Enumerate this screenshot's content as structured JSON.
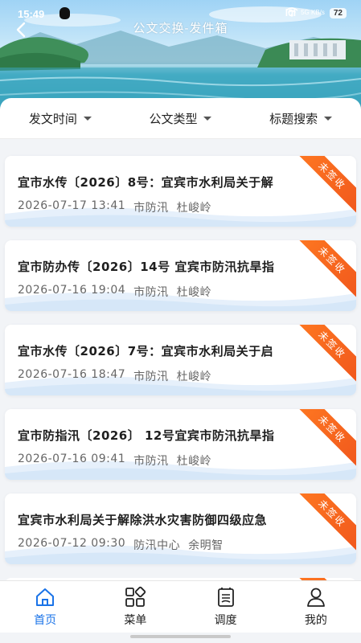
{
  "status_bar": {
    "time": "15:49",
    "signal": "l0l",
    "network": "5G\nKB/s",
    "battery": "72"
  },
  "header": {
    "title": "公文交换-发件箱"
  },
  "filters": [
    {
      "label": "发文时间"
    },
    {
      "label": "公文类型"
    },
    {
      "label": "标题搜索"
    }
  ],
  "documents": [
    {
      "title": "宜市水传〔2026〕8号：宜宾市水利局关于解",
      "date": "2026-07-17 13:41",
      "dept": "市防汛",
      "person": "杜峻岭",
      "status": "未签收"
    },
    {
      "title": "宜市防办传〔2026〕14号 宜宾市防汛抗旱指",
      "date": "2026-07-16 19:04",
      "dept": "市防汛",
      "person": "杜峻岭",
      "status": "未签收"
    },
    {
      "title": "宜市水传〔2026〕7号：宜宾市水利局关于启",
      "date": "2026-07-16 18:47",
      "dept": "市防汛",
      "person": "杜峻岭",
      "status": "未签收"
    },
    {
      "title": "宜市防指汛〔2026〕 12号宜宾市防汛抗旱指",
      "date": "2026-07-16 09:41",
      "dept": "市防汛",
      "person": "杜峻岭",
      "status": "未签收"
    },
    {
      "title": "宜宾市水利局关于解除洪水灾害防御四级应急",
      "date": "2026-07-12 09:30",
      "dept": "防汛中心",
      "person": "余明智",
      "status": "未签收"
    }
  ],
  "nav": [
    {
      "label": "首页",
      "icon": "home-icon",
      "active": true
    },
    {
      "label": "菜单",
      "icon": "grid-icon",
      "active": false
    },
    {
      "label": "调度",
      "icon": "schedule-icon",
      "active": false
    },
    {
      "label": "我的",
      "icon": "user-icon",
      "active": false
    }
  ],
  "colors": {
    "accent": "#1a73e8",
    "ribbon": "#f0561c"
  }
}
